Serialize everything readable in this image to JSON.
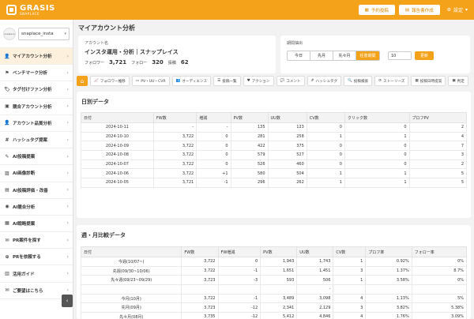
{
  "header": {
    "logo_main": "GRASIS",
    "logo_sub": "SNAPLACE",
    "btn_schedule": "予約投稿",
    "btn_report": "報告書作成",
    "settings": "設定"
  },
  "sidebar": {
    "account_select": "snaplace_insta",
    "avatar_text": "snaplace",
    "items": [
      {
        "label": "マイアカウント分析",
        "icon": "user-icon",
        "glyph": "👤"
      },
      {
        "label": "ベンチマーク分析",
        "icon": "flag-icon",
        "glyph": "⚑"
      },
      {
        "label": "タグ付けファン分析",
        "icon": "tag-icon",
        "glyph": "🏷"
      },
      {
        "label": "競合アカウント分析",
        "icon": "compare-icon",
        "glyph": "▣"
      },
      {
        "label": "アカウント品質分析",
        "icon": "user-check-icon",
        "glyph": "👤"
      },
      {
        "label": "ハッシュタグ提案",
        "icon": "hashtag-icon",
        "glyph": "#"
      },
      {
        "label": "AI投稿提案",
        "icon": "ai-post-icon",
        "glyph": "✎"
      },
      {
        "label": "AI画像診断",
        "icon": "image-icon",
        "glyph": "▨"
      },
      {
        "label": "AI投稿評価・改善",
        "icon": "chart-icon",
        "glyph": "▤"
      },
      {
        "label": "AI競合分析",
        "icon": "ai-compare-icon",
        "glyph": "◉"
      },
      {
        "label": "AI戦略提案",
        "icon": "strategy-icon",
        "glyph": "▦"
      },
      {
        "label": "PR案件を探す",
        "icon": "pr-search-icon",
        "glyph": "✉"
      },
      {
        "label": "PRを依頼する",
        "icon": "pr-request-icon",
        "glyph": "⊕"
      },
      {
        "label": "活用ガイド",
        "icon": "book-icon",
        "glyph": "▥"
      },
      {
        "label": "ご要望はこちら",
        "icon": "chat-icon",
        "glyph": "✉"
      }
    ]
  },
  "page_title": "マイアカウント分析",
  "account_card": {
    "label": "アカウント名",
    "name": "インスタ運用・分析｜スナップレイス",
    "followers_label": "フォロワー",
    "followers": "3,721",
    "following_label": "フォロー",
    "following": "320",
    "posts_label": "投稿",
    "posts": "62"
  },
  "period": {
    "label": "期間抽出",
    "options": [
      "今日",
      "先月",
      "先々月",
      "任意期間"
    ],
    "selected": 3,
    "date_value": "10",
    "update_label": "更新"
  },
  "tabs": [
    {
      "label": "フォロワー推移",
      "icon": "line-chart-icon",
      "glyph": "📈"
    },
    {
      "label": "PV・UU・CVR",
      "icon": "folder-icon",
      "glyph": "▭"
    },
    {
      "label": "オーディエンス",
      "icon": "audience-icon",
      "glyph": "👥"
    },
    {
      "label": "投稿一覧",
      "icon": "list-icon",
      "glyph": "☰"
    },
    {
      "label": "アクション",
      "icon": "heart-icon",
      "glyph": "♥"
    },
    {
      "label": "コメント",
      "icon": "comment-icon",
      "glyph": "💬"
    },
    {
      "label": "ハッシュタグ",
      "icon": "hashtag-icon",
      "glyph": "#"
    },
    {
      "label": "投稿検索",
      "icon": "search-icon",
      "glyph": "🔍"
    },
    {
      "label": "ストーリーズ",
      "icon": "story-icon",
      "glyph": "⟳"
    },
    {
      "label": "投稿日時提案",
      "icon": "calendar-icon",
      "glyph": "▦"
    },
    {
      "label": "判定",
      "icon": "judge-icon",
      "glyph": "▣"
    }
  ],
  "daily": {
    "title": "日別データ",
    "columns": [
      "日付",
      "FW数",
      "増減",
      "PV数",
      "UU数",
      "CV数",
      "クリック数",
      "プロフPV"
    ],
    "rows": [
      [
        "2024-10-11",
        "-",
        "-",
        "135",
        "123",
        "0",
        "0",
        "2"
      ],
      [
        "2024-10-10",
        "3,722",
        "0",
        "281",
        "258",
        "1",
        "1",
        "4"
      ],
      [
        "2024-10-09",
        "3,722",
        "0",
        "422",
        "375",
        "0",
        "0",
        "7"
      ],
      [
        "2024-10-08",
        "3,722",
        "0",
        "579",
        "527",
        "0",
        "0",
        "3"
      ],
      [
        "2024-10-07",
        "3,722",
        "0",
        "526",
        "460",
        "0",
        "0",
        "2"
      ],
      [
        "2024-10-06",
        "3,722",
        "+1",
        "580",
        "504",
        "1",
        "1",
        "5"
      ],
      [
        "2024-10-05",
        "3,721",
        "-1",
        "296",
        "262",
        "1",
        "1",
        "5"
      ]
    ]
  },
  "weekly": {
    "title": "週・月比較データ",
    "columns": [
      "日付",
      "FW数",
      "FW増減",
      "PV数",
      "UU数",
      "CV数",
      "プロフ率",
      "フォロー率"
    ],
    "rows": [
      [
        "今週(10/07~)",
        "3,722",
        "0",
        "1,943",
        "1,743",
        "1",
        "0.92%",
        "0%"
      ],
      [
        "先週(09/30~10/06)",
        "3,722",
        "-1",
        "1,651",
        "1,451",
        "3",
        "1.37%",
        "8.7%"
      ],
      [
        "先々週(09/23~09/29)",
        "3,723",
        "-3",
        "593",
        "506",
        "1",
        "3.58%",
        "0%"
      ],
      [
        "",
        "",
        "",
        "",
        "-",
        "",
        "",
        ""
      ],
      [
        "今月(10月)",
        "3,722",
        "-1",
        "3,489",
        "3,098",
        "4",
        "1.13%",
        "5%"
      ],
      [
        "先月(09月)",
        "3,723",
        "-12",
        "2,341",
        "2,129",
        "3",
        "3.82%",
        "5.38%"
      ],
      [
        "先々月(08月)",
        "3,735",
        "-12",
        "5,412",
        "4,846",
        "4",
        "1.76%",
        "3.09%"
      ]
    ]
  }
}
